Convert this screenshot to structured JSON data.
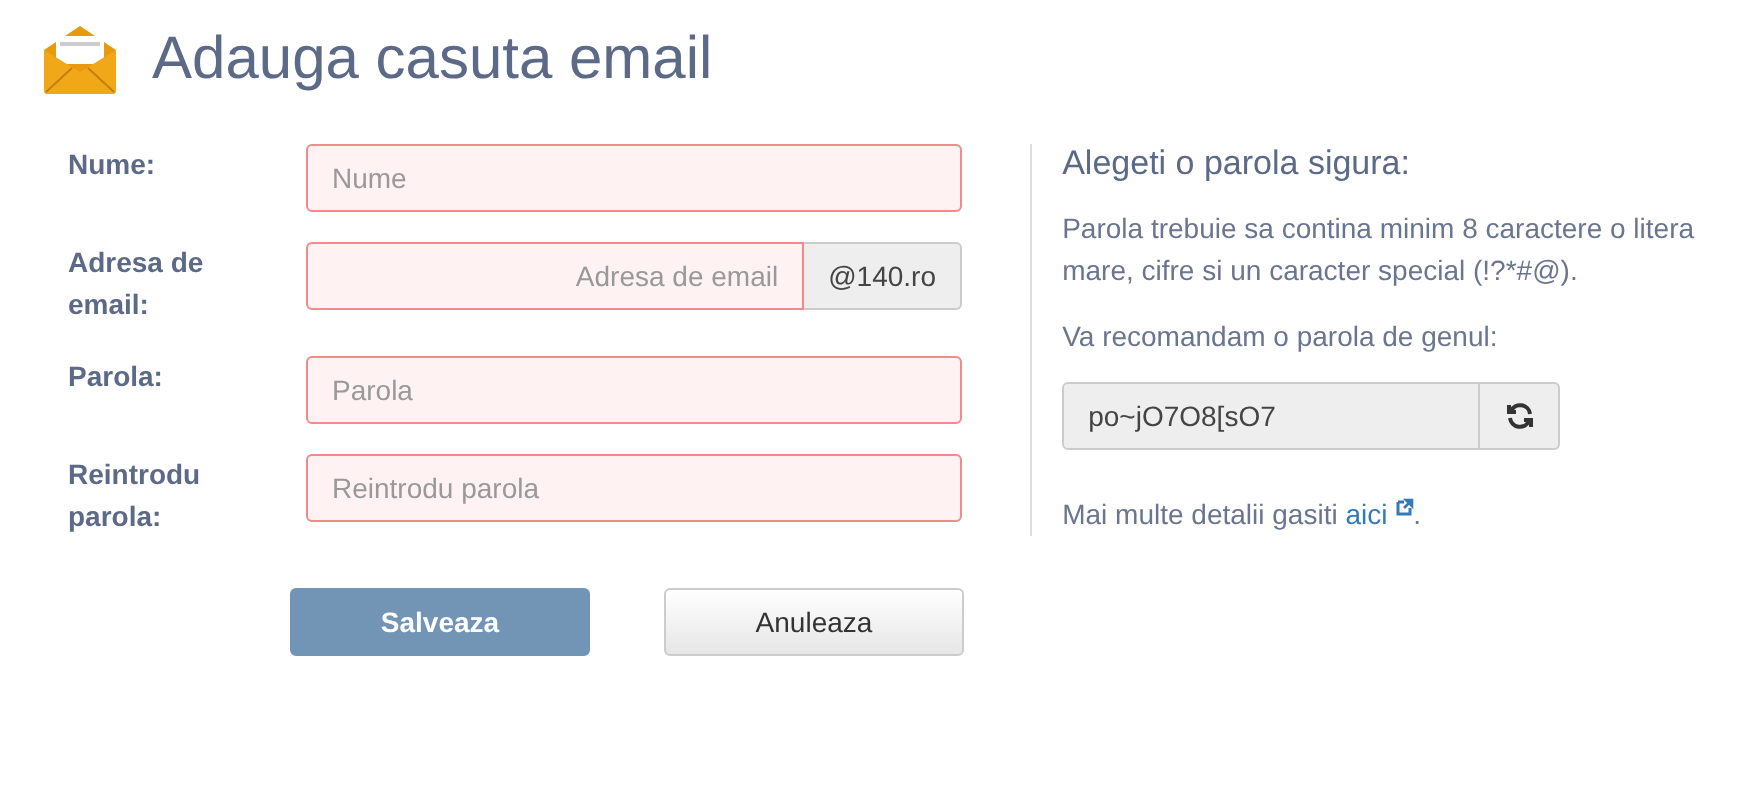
{
  "title": "Adauga casuta email",
  "fields": [
    {
      "kind": "text",
      "label": "Nume:",
      "placeholder": "Nume",
      "invalid": true
    },
    {
      "kind": "addon",
      "label": "Adresa de email:",
      "placeholder": "Adresa de email",
      "addon": "@140.ro",
      "invalid": true
    },
    {
      "kind": "text",
      "label": "Parola:",
      "placeholder": "Parola",
      "invalid": true
    },
    {
      "kind": "text",
      "label": "Reintrodu parola:",
      "placeholder": "Reintrodu parola",
      "invalid": true
    }
  ],
  "buttons": [
    {
      "kind": "primary",
      "label": "Salveaza"
    },
    {
      "kind": "default",
      "label": "Anuleaza"
    }
  ],
  "tips": {
    "heading": "Alegeti o parola sigura:",
    "rules": "Parola trebuie sa contina minim 8 caractere o litera mare, cifre si un caracter special (!?*#@).",
    "suggest_label": "Va recomandam o parola de genul:",
    "suggestion": "po~jO7O8[sO7",
    "more_text": "Mai multe detalii gasiti",
    "more_link": "aici",
    "more_end": "."
  }
}
